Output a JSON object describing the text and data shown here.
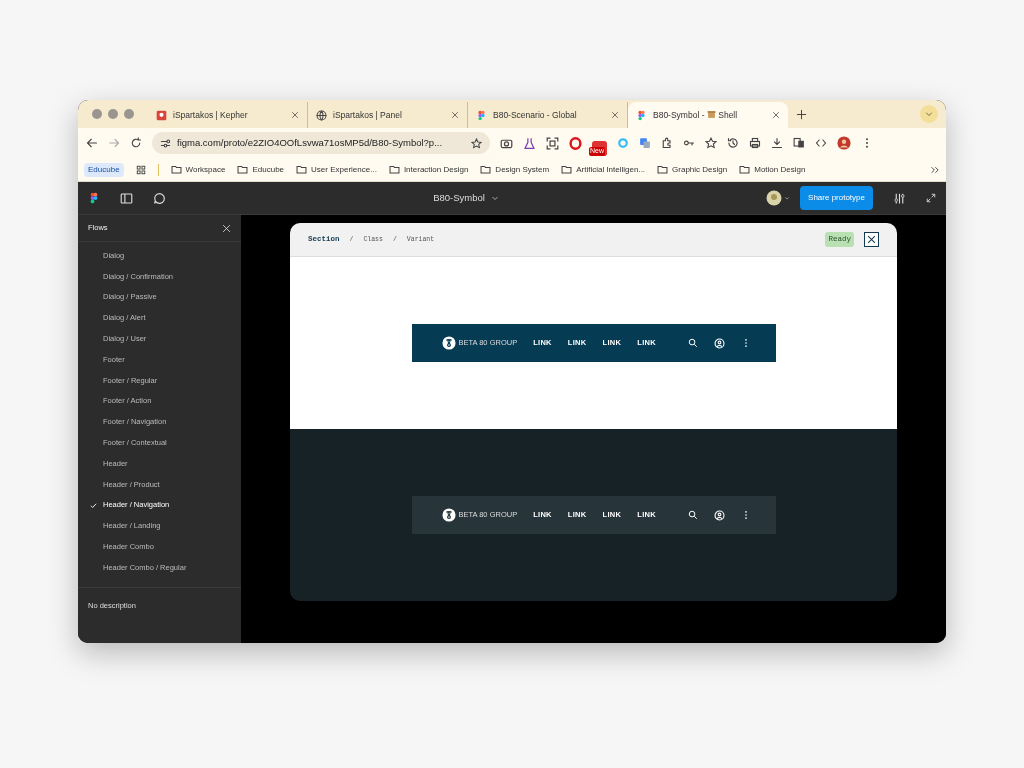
{
  "browser": {
    "tabs": [
      {
        "title": "iSpartakos | Kepher",
        "kind": "app",
        "selected": false
      },
      {
        "title": "iSpartakos | Panel",
        "kind": "web",
        "selected": false
      },
      {
        "title": "B80-Scenario - Global",
        "kind": "figma",
        "selected": false
      },
      {
        "title": "B80-Symbol -",
        "suffix": "Shell",
        "kind": "figma",
        "selected": true
      }
    ],
    "url": "figma.com/proto/e2ZIO4OOfLsvwa71osMP5d/B80-Symbol?p...",
    "extension_badge": "New",
    "bookmarks": [
      {
        "label": "Educube",
        "kind": "chip"
      },
      {
        "kind": "apps"
      },
      {
        "label": "Workspace",
        "kind": "folder"
      },
      {
        "label": "Educube",
        "kind": "folder"
      },
      {
        "label": "User Experience...",
        "kind": "folder"
      },
      {
        "label": "Interaction Design",
        "kind": "folder"
      },
      {
        "label": "Design System",
        "kind": "folder"
      },
      {
        "label": "Artificial Intelligen...",
        "kind": "folder"
      },
      {
        "label": "Graphic Design",
        "kind": "folder"
      },
      {
        "label": "Motion Design",
        "kind": "folder"
      }
    ]
  },
  "toolbar": {
    "file_title": "B80-Symbol",
    "share_button": "Share prototype"
  },
  "sidebar": {
    "title": "Flows",
    "items": [
      {
        "label": "Dialog",
        "selected": false
      },
      {
        "label": "Dialog / Confirmation",
        "selected": false
      },
      {
        "label": "Dialog / Passive",
        "selected": false
      },
      {
        "label": "Dialog / Alert",
        "selected": false
      },
      {
        "label": "Dialog / User",
        "selected": false
      },
      {
        "label": "Footer",
        "selected": false
      },
      {
        "label": "Footer / Regular",
        "selected": false
      },
      {
        "label": "Footer / Action",
        "selected": false
      },
      {
        "label": "Footer / Navigation",
        "selected": false
      },
      {
        "label": "Footer / Contextual",
        "selected": false
      },
      {
        "label": "Header",
        "selected": false
      },
      {
        "label": "Header / Product",
        "selected": false
      },
      {
        "label": "Header / Navigation",
        "selected": true
      },
      {
        "label": "Header / Landing",
        "selected": false
      },
      {
        "label": "Header Combo",
        "selected": false
      },
      {
        "label": "Header Combo / Regular",
        "selected": false
      }
    ],
    "description": "No description"
  },
  "prototype": {
    "breadcrumb": [
      "Section",
      "Class",
      "Variant"
    ],
    "breadcrumb_separators": [
      "/",
      "/"
    ],
    "status_badge": "Ready",
    "headers": [
      {
        "kind": "light",
        "brand": "BETA 80 GROUP",
        "links": [
          "LINK",
          "LINK",
          "LINK",
          "LINK"
        ]
      },
      {
        "kind": "dark",
        "brand": "BETA 80 GROUP",
        "links": [
          "LINK",
          "LINK",
          "LINK",
          "LINK"
        ]
      }
    ]
  }
}
